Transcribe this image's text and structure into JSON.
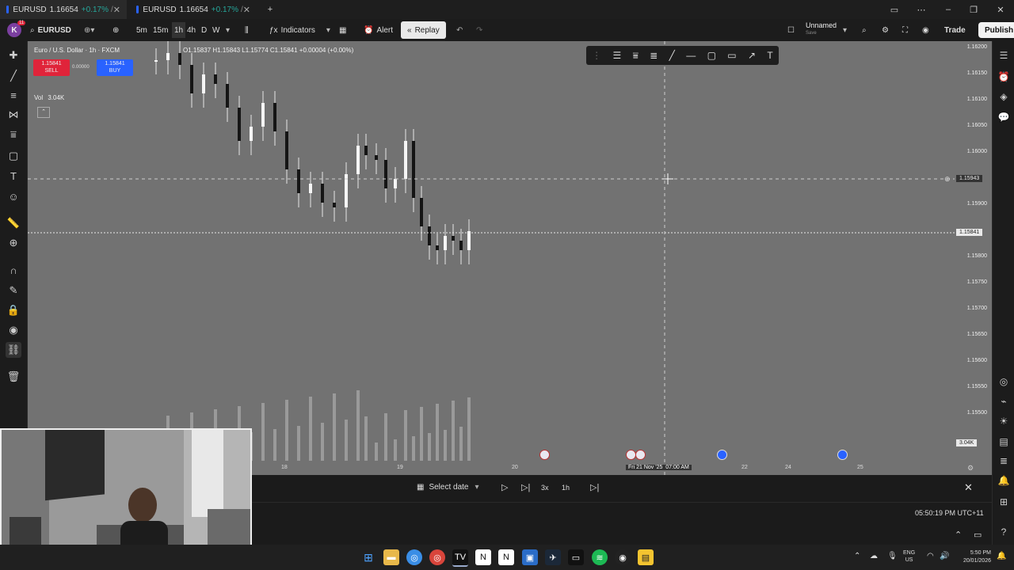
{
  "browser_tabs": [
    {
      "title": "EURUSD",
      "price": "1.16654",
      "change": "+0.17%",
      "suffix": "/"
    },
    {
      "title": "EURUSD",
      "price": "1.16654",
      "change": "+0.17%",
      "suffix": "/"
    }
  ],
  "toolbar": {
    "avatar_letter": "K",
    "notif_count": "11",
    "symbol": "EURUSD",
    "intervals": [
      "5m",
      "15m",
      "1h",
      "4h",
      "D",
      "W"
    ],
    "indicators_label": "Indicators",
    "alert_label": "Alert",
    "replay_label": "Replay",
    "layout_name": "Unnamed",
    "layout_sub": "Save",
    "trade_label": "Trade",
    "publish_label": "Publish"
  },
  "chart": {
    "symbol_desc": "Euro / U.S. Dollar · 1h · FXCM",
    "ohlc": "O1.15837 H1.15843 L1.15774 C1.15841 +0.00004 (+0.00%)",
    "sell_price": "1.15841",
    "sell_label": "SELL",
    "spread": "0.00000",
    "buy_price": "1.15841",
    "buy_label": "BUY",
    "vol_label": "Vol",
    "vol_value": "3.04K",
    "crosshair_price": "1.15943",
    "last_price": "1.15841",
    "vol_right": "3.04K",
    "price_ticks": [
      "1.16200",
      "1.16150",
      "1.16100",
      "1.16050",
      "1.16000",
      "1.15943",
      "1.15900",
      "1.15841",
      "1.15800",
      "1.15750",
      "1.15700",
      "1.15650",
      "1.15600",
      "1.15550",
      "1.15500"
    ],
    "time_ticks": [
      "18",
      "19",
      "20",
      "22",
      "24",
      "25"
    ],
    "crosshair_time": "Fri 21 Nov '25  07:00 AM"
  },
  "chart_data": {
    "type": "candlestick",
    "interval": "1h",
    "symbol": "EURUSD",
    "ylim": [
      1.1545,
      1.1623
    ],
    "last_close": 1.15841,
    "candles_visible_count": "approx 150 hourly candles from 17 Nov to 21 Nov",
    "volume_last": "3.04K"
  },
  "replay_bar": {
    "select_date": "Select date",
    "speed": "3x",
    "interval": "1h"
  },
  "status": {
    "time": "05:50:19 PM UTC+11"
  },
  "taskbar": {
    "lang_top": "ENG",
    "lang_bottom": "US",
    "clock_time": "5:50 PM",
    "clock_date": "20/01/2026"
  },
  "colors": {
    "accent": "#2962ff",
    "sell": "#e0243a",
    "buy": "#2962ff",
    "bg_chart": "#727272"
  }
}
